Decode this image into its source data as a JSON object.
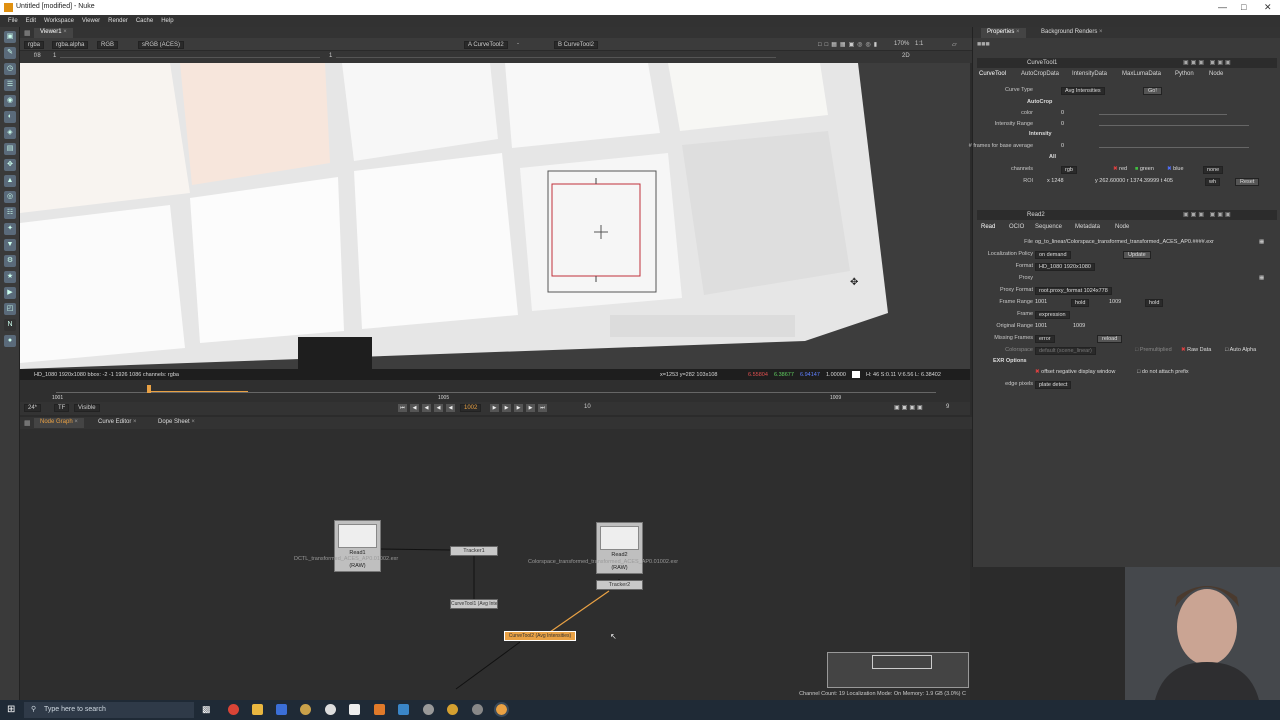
{
  "window": {
    "title": "Untitled [modified] - Nuke"
  },
  "menu": [
    "File",
    "Edit",
    "Workspace",
    "Viewer",
    "Render",
    "Cache",
    "Help"
  ],
  "viewer": {
    "tab": "Viewer1",
    "channels": "rgba",
    "alpha": "rgba.alpha",
    "display": "RGB",
    "colorspace": "sRGB (ACES)",
    "input_a": "A  CurveTool2",
    "input_a_sep": "-",
    "input_b": "B  CurveTool2",
    "zoom": "170%",
    "ratio": "1:1",
    "mode": "2D",
    "gain_label": "f/8",
    "gain_value": "1",
    "gamma_value": "1",
    "format_info": "HD_1080 1920x1080  bbox: -2 -1 1926 1086 channels: rgba",
    "pixel_info": "x=1253 y=282 103x108",
    "pixel_r": "6.55804",
    "pixel_g": "6.38677",
    "pixel_b": "6.94147",
    "pixel_a": "1.00000",
    "pixel_hsvl": "H: 46 S:0.11 V:6.56  L: 6.38402"
  },
  "timeline": {
    "start": "1001",
    "mid": "1005",
    "end": "1009",
    "current": "1002",
    "fps": "24*",
    "tf": "TF",
    "visible": "Visible",
    "step": "10",
    "frame_count": "9"
  },
  "nodegraph_tabs": [
    "Node Graph",
    "Curve Editor",
    "Dope Sheet"
  ],
  "nodes": {
    "read1": {
      "label": "Read1",
      "sub": "DCTL_transformed_ACES_AP0.01002.exr",
      "raw": "(RAW)"
    },
    "read2": {
      "label": "Read2",
      "sub": "Colorspace_transformed_transformed_ACES_AP0.01002.exr",
      "raw": "(RAW)"
    },
    "tracker1": "Tracker1",
    "tracker2": "Tracker2",
    "curvetool1": "CurveTool1 (Avg Intensities)",
    "curvetool2": "CurveTool2 (Avg Intensities)"
  },
  "ng_status": "Channel Count: 19  Localization Mode: On  Memory: 1.9 GB (3.0%)  C",
  "properties": {
    "tabs": [
      "Properties",
      "Background Renders"
    ],
    "curvetool": {
      "name": "CurveTool1",
      "tabs": [
        "CurveTool",
        "AutoCropData",
        "IntensityData",
        "MaxLumaData",
        "Python",
        "Node"
      ],
      "curve_type_label": "Curve Type",
      "curve_type": "Avg Intensities",
      "go": "Go!",
      "autocrop": "AutoCrop",
      "color_label": "color",
      "color_value": "0",
      "intensity_range_label": "Intensity Range",
      "intensity_range_value": "0",
      "intensity": "Intensity",
      "frames_label": "# frames for base average",
      "frames_value": "0",
      "all": "All",
      "channels_label": "channels",
      "channels_value": "rgb",
      "red": "red",
      "green": "green",
      "blue": "blue",
      "none": "none",
      "roi_label": "ROI",
      "roi_value": "x 1248",
      "roi_rest": "y 262.60000  r 1374.39999 t 405",
      "wh": "wh",
      "reset": "Reset"
    },
    "read": {
      "name": "Read2",
      "tabs": [
        "Read",
        "OCIO",
        "Sequence",
        "Metadata",
        "Node"
      ],
      "file_label": "File",
      "file_value": "og_to_linear/Colorspace_transformed_transformed_ACES_AP0.####.exr",
      "localization_label": "Localization Policy",
      "localization_value": "on demand",
      "update": "Update",
      "format_label": "Format",
      "format_value": "HD_1080 1920x1080",
      "proxy_label": "Proxy",
      "proxy_format_label": "Proxy Format",
      "proxy_format_value": "root.proxy_format 1024x778",
      "frame_range_label": "Frame Range",
      "frame_range_start": "1001",
      "frame_range_before": "hold",
      "frame_range_end": "1009",
      "frame_range_after": "hold",
      "frame_label": "Frame",
      "frame_value": "expression",
      "original_range_label": "Original Range",
      "original_start": "1001",
      "original_end": "1009",
      "missing_frames_label": "Missing Frames",
      "missing_frames_value": "error",
      "reload": "reload",
      "colorspace_label": "Colorspace",
      "colorspace_value": "default (scene_linear)",
      "premultiplied": "Premultiplied",
      "raw_data": "Raw Data",
      "auto_alpha": "Auto Alpha",
      "exr_options": "EXR Options",
      "offset_negative": "offset negative display window",
      "no_prefix": "do not attach prefix",
      "edge_pixels_label": "edge pixels",
      "edge_pixels_value": "plate detect"
    }
  },
  "taskbar": {
    "search_placeholder": "Type here to search"
  },
  "colors": {
    "accent": "#e9a144",
    "viewer_bg": "#3a3a3a",
    "roi_red": "#c0303a"
  }
}
